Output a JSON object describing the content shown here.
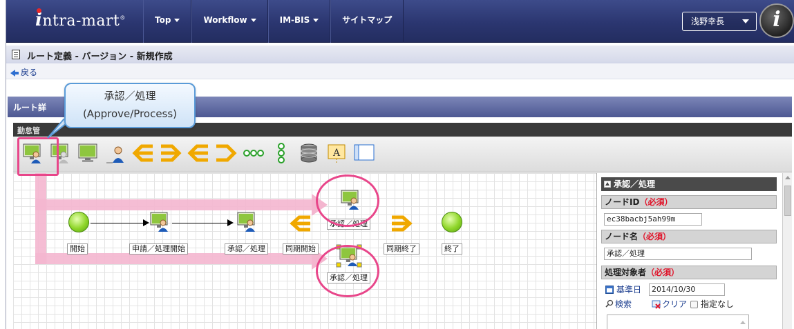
{
  "header": {
    "logo": "intra-mart",
    "nav": [
      "Top",
      "Workflow",
      "IM-BIS",
      "サイトマップ"
    ],
    "user": "浅野幸長"
  },
  "page": {
    "title": "ルート定義 - バージョン - 新規作成",
    "back": "戻る",
    "section_title": "ルート詳",
    "panel_title": "勤怠管"
  },
  "callout": {
    "line1": "承認／処理",
    "line2": "(Approve/Process)"
  },
  "flow": {
    "start": "開始",
    "apply": "申請／処理開始",
    "approve": "承認／処理",
    "sync_start": "同期開始",
    "approve_top": "承認／処理",
    "sync_end": "同期終了",
    "end": "終了",
    "approve_bottom": "承認／処理"
  },
  "props": {
    "header": "承認／処理",
    "node_id_label": "ノードID",
    "node_id_value": "ec38bacbj5ah99m",
    "node_name_label": "ノード名",
    "node_name_value": "承認／処理",
    "target_label": "処理対象者",
    "required": "（必須）",
    "base_date_label": "基準日",
    "base_date_value": "2014/10/30",
    "search": "検索",
    "clear": "クリア",
    "none": "指定なし"
  },
  "colors": {
    "header": "#2b3670",
    "highlight": "#e8468a",
    "required": "#e0142a",
    "callout_border": "#5a9bd8"
  }
}
